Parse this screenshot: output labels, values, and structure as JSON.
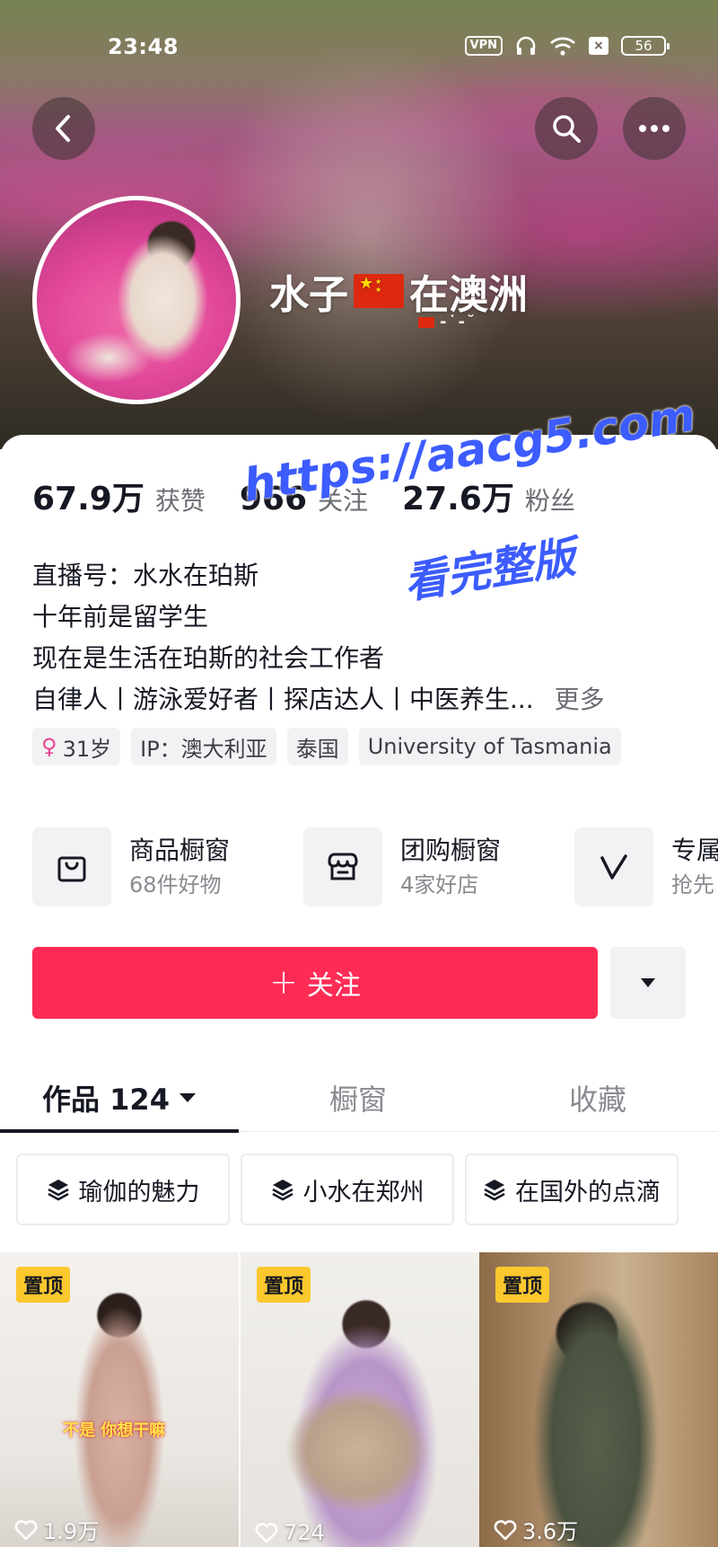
{
  "status_bar": {
    "time": "23:48",
    "vpn": "VPN",
    "battery": "56",
    "sim": "×"
  },
  "profile": {
    "name_before_flag": "水子",
    "name_after_flag": "在澳洲"
  },
  "stats": [
    {
      "value": "67.9万",
      "label": "获赞"
    },
    {
      "value": "966",
      "label": "关注"
    },
    {
      "value": "27.6万",
      "label": "粉丝"
    }
  ],
  "bio": {
    "lines": [
      "直播号：水水在珀斯",
      "十年前是留学生",
      "现在是生活在珀斯的社会工作者",
      "自律人丨游泳爱好者丨探店达人丨中医养生..."
    ],
    "more": "更多"
  },
  "tags": {
    "gender_symbol": "♀",
    "age": "31岁",
    "ip": "IP：澳大利亚",
    "country": "泰国",
    "school": "University of Tasmania"
  },
  "shops": [
    {
      "title": "商品橱窗",
      "subtitle": "68件好物"
    },
    {
      "title": "团购橱窗",
      "subtitle": "4家好店"
    },
    {
      "title": "专属",
      "subtitle": "抢先"
    }
  ],
  "follow": {
    "plus": "+",
    "label": "关注"
  },
  "tabs": {
    "works": "作品 124",
    "shop": "橱窗",
    "favorites": "收藏"
  },
  "collections": [
    "瑜伽的魅力",
    "小水在郑州",
    "在国外的点滴"
  ],
  "videos": [
    {
      "pin": "置顶",
      "caption": "不是 你想干嘛",
      "likes": "1.9万"
    },
    {
      "pin": "置顶",
      "likes": "724"
    },
    {
      "pin": "置顶",
      "likes": "3.6万"
    }
  ],
  "watermark": {
    "url": "https://aacg5.com",
    "sub": "看完整版"
  },
  "colors": {
    "follow_button": "#fe2c55",
    "pin_badge": "#fbc82e",
    "watermark": "#3c5cff"
  }
}
